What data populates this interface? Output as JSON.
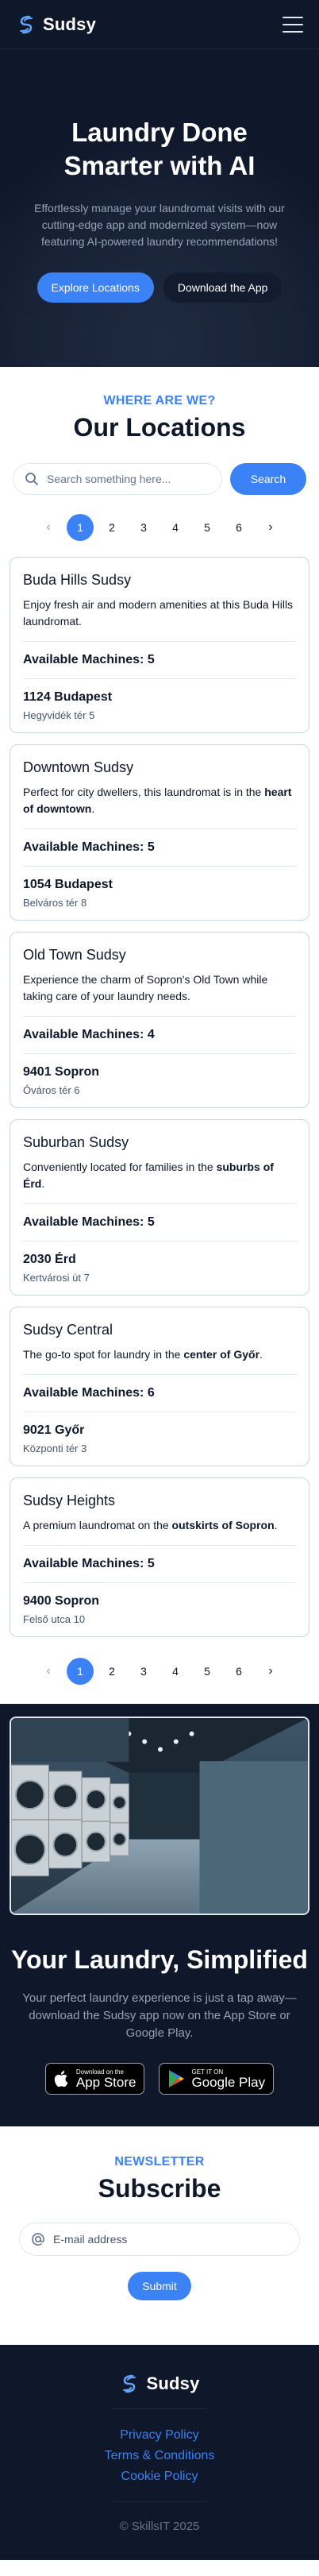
{
  "header": {
    "brand": "Sudsy",
    "menu_icon": "hamburger-menu-icon"
  },
  "hero": {
    "title": "Laundry Done Smarter with AI",
    "subtitle": "Effortlessly manage your laundromat visits with our cutting-edge app and modernized system—now featuring AI-powered laundry recommendations!",
    "primary_cta": "Explore Locations",
    "secondary_cta": "Download the App"
  },
  "locations": {
    "eyebrow": "WHERE ARE WE?",
    "title": "Our Locations",
    "search_placeholder": "Search something here...",
    "search_button": "Search",
    "pages": [
      "1",
      "2",
      "3",
      "4",
      "5",
      "6"
    ],
    "active_page": "1",
    "machines_label": "Available Machines:",
    "cards": [
      {
        "name": "Buda Hills Sudsy",
        "desc_parts": [
          [
            "Enjoy fresh air and modern amenities at this Buda Hills laundromat.",
            false
          ]
        ],
        "machines": "5",
        "city": "1124 Budapest",
        "street": "Hegyvidék tér 5"
      },
      {
        "name": "Downtown Sudsy",
        "desc_parts": [
          [
            "Perfect for city dwellers, this laundromat is in the ",
            false
          ],
          [
            "heart of downtown",
            true
          ],
          [
            ".",
            false
          ]
        ],
        "machines": "5",
        "city": "1054 Budapest",
        "street": "Belváros tér 8"
      },
      {
        "name": "Old Town Sudsy",
        "desc_parts": [
          [
            "Experience the charm of Sopron's Old Town while taking care of your laundry needs.",
            false
          ]
        ],
        "machines": "4",
        "city": "9401 Sopron",
        "street": "Óváros tér 6"
      },
      {
        "name": "Suburban Sudsy",
        "desc_parts": [
          [
            "Conveniently located for families in the ",
            false
          ],
          [
            "suburbs of Érd",
            true
          ],
          [
            ".",
            false
          ]
        ],
        "machines": "5",
        "city": "2030 Érd",
        "street": "Kertvárosi út 7"
      },
      {
        "name": "Sudsy Central",
        "desc_parts": [
          [
            "The go-to spot for laundry in the ",
            false
          ],
          [
            "center of Győr",
            true
          ],
          [
            ".",
            false
          ]
        ],
        "machines": "6",
        "city": "9021 Győr",
        "street": "Központi tér 3"
      },
      {
        "name": "Sudsy Heights",
        "desc_parts": [
          [
            "A premium laundromat on the ",
            false
          ],
          [
            "outskirts of Sopron",
            true
          ],
          [
            ".",
            false
          ]
        ],
        "machines": "5",
        "city": "9400 Sopron",
        "street": "Felső utca 10"
      }
    ]
  },
  "promo": {
    "image_icon": "laundromat-photo",
    "title": "Your Laundry, Simplified",
    "text": "Your perfect laundry experience is just a tap away—download the Sudsy app now on the App Store or Google Play.",
    "app_store": {
      "small": "Download on the",
      "big": "App Store"
    },
    "google_play": {
      "small": "GET IT ON",
      "big": "Google Play"
    }
  },
  "newsletter": {
    "eyebrow": "NEWSLETTER",
    "title": "Subscribe",
    "email_placeholder": "E-mail address",
    "submit": "Submit"
  },
  "footer": {
    "brand": "Sudsy",
    "links": [
      "Privacy Policy",
      "Terms & Conditions",
      "Cookie Policy"
    ],
    "copyright": "© SkillsIT 2025"
  },
  "colors": {
    "navy": "#0f172a",
    "accent": "#3b82f6",
    "muted": "#94a3b8"
  }
}
